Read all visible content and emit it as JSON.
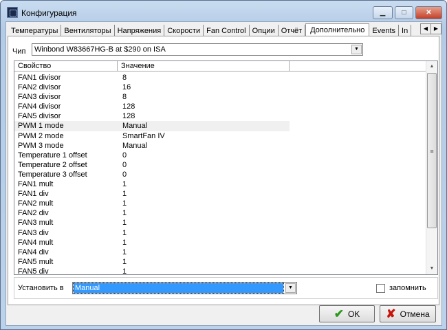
{
  "window": {
    "title": "Конфигурация"
  },
  "tabs": [
    "Температуры",
    "Вентиляторы",
    "Напряжения",
    "Скорости",
    "Fan Control",
    "Опции",
    "Отчёт",
    "Дополнительно",
    "Events",
    "In"
  ],
  "active_tab": "Дополнительно",
  "chip": {
    "label": "Чип",
    "value": "Winbond W83667HG-B at $290 on ISA"
  },
  "table": {
    "headers": [
      "Свойство",
      "Значение"
    ],
    "rows": [
      [
        "FAN1 divisor",
        "8"
      ],
      [
        "FAN2 divisor",
        "16"
      ],
      [
        "FAN3 divisor",
        "8"
      ],
      [
        "FAN4 divisor",
        "128"
      ],
      [
        "FAN5 divisor",
        "128"
      ],
      [
        "PWM 1 mode",
        "Manual"
      ],
      [
        "PWM 2 mode",
        "SmartFan IV"
      ],
      [
        "PWM 3 mode",
        "Manual"
      ],
      [
        "Temperature 1 offset",
        "0"
      ],
      [
        "Temperature 2 offset",
        "0"
      ],
      [
        "Temperature 3 offset",
        "0"
      ],
      [
        "FAN1 mult",
        "1"
      ],
      [
        "FAN1 div",
        "1"
      ],
      [
        "FAN2 mult",
        "1"
      ],
      [
        "FAN2 div",
        "1"
      ],
      [
        "FAN3 mult",
        "1"
      ],
      [
        "FAN3 div",
        "1"
      ],
      [
        "FAN4 mult",
        "1"
      ],
      [
        "FAN4 div",
        "1"
      ],
      [
        "FAN5 mult",
        "1"
      ],
      [
        "FAN5 div",
        "1"
      ]
    ],
    "selected_row": 5
  },
  "set": {
    "label": "Установить в",
    "value": "Manual"
  },
  "remember": {
    "label": "запомнить",
    "checked": false
  },
  "buttons": {
    "ok": "OK",
    "cancel": "Отмена"
  },
  "colors": {
    "selection": "#3399ff"
  }
}
